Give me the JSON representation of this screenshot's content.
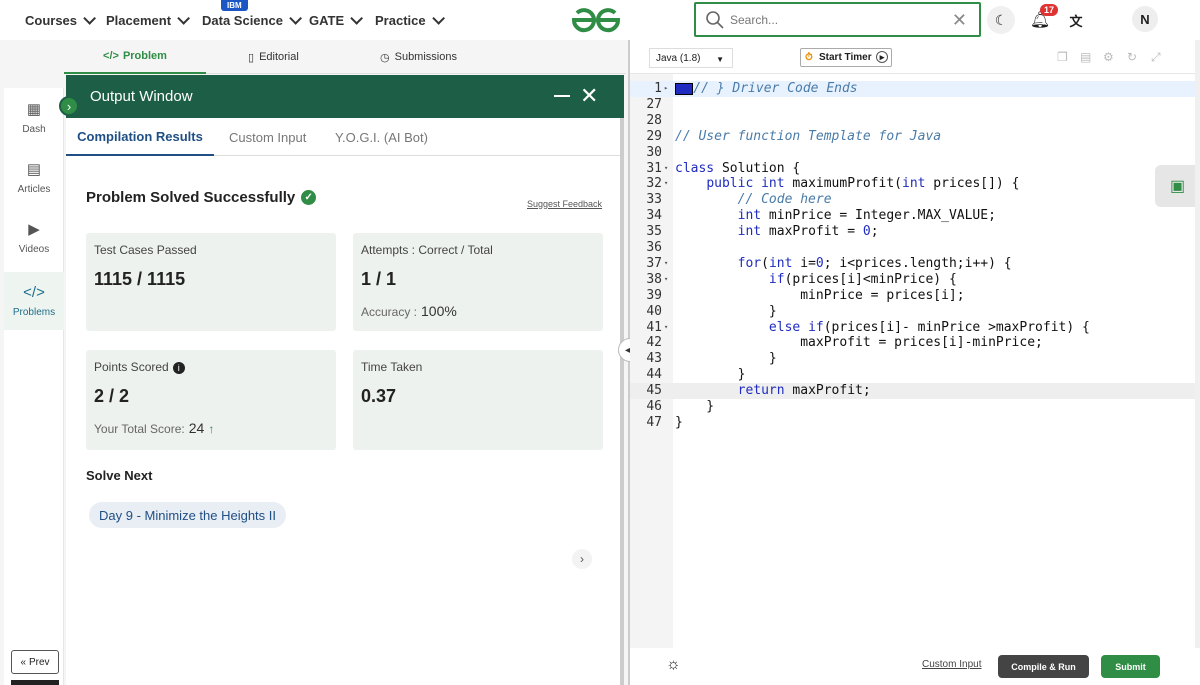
{
  "nav": {
    "items": [
      {
        "label": "Courses"
      },
      {
        "label": "Placement"
      },
      {
        "label": "Data Science"
      },
      {
        "label": "GATE"
      },
      {
        "label": "Practice"
      }
    ],
    "ibm_badge": "IBM",
    "search_placeholder": "Search...",
    "notification_count": "17",
    "avatar_initial": "N"
  },
  "problem_tabs": [
    "Problem",
    "Editorial",
    "Submissions"
  ],
  "sidebar": {
    "items": [
      {
        "label": "Dash",
        "icon": "dashboard-icon"
      },
      {
        "label": "Articles",
        "icon": "book-icon"
      },
      {
        "label": "Videos",
        "icon": "video-icon"
      },
      {
        "label": "Problems",
        "icon": "code-icon"
      }
    ],
    "prev_label": "Prev"
  },
  "output": {
    "title": "Output Window",
    "tabs": [
      "Compilation Results",
      "Custom Input",
      "Y.O.G.I. (AI Bot)"
    ],
    "status": "Problem Solved Successfully",
    "suggest": "Suggest Feedback",
    "cards": {
      "test_label": "Test Cases Passed",
      "test_value": "1115 / 1115",
      "attempts_label": "Attempts : Correct / Total",
      "attempts_value": "1 / 1",
      "accuracy_label": "Accuracy :",
      "accuracy_value": "100%",
      "points_label": "Points Scored",
      "points_value": "2 / 2",
      "score_label": "Your Total Score:",
      "score_value": "24",
      "time_label": "Time Taken",
      "time_value": "0.37"
    },
    "solve_next_label": "Solve Next",
    "next_problem": "Day 9 - Minimize the Heights II"
  },
  "editor": {
    "language": "Java (1.8)",
    "timer_label": "Start Timer",
    "lines": [
      {
        "n": "1",
        "t": "// } Driver Code Ends"
      },
      {
        "n": "27",
        "t": ""
      },
      {
        "n": "28",
        "t": ""
      },
      {
        "n": "29",
        "t": "// User function Template for Java"
      },
      {
        "n": "30",
        "t": ""
      },
      {
        "n": "31",
        "t": "class Solution {"
      },
      {
        "n": "32",
        "t": "    public int maximumProfit(int prices[]) {"
      },
      {
        "n": "33",
        "t": "        // Code here"
      },
      {
        "n": "34",
        "t": "        int minPrice = Integer.MAX_VALUE;"
      },
      {
        "n": "35",
        "t": "        int maxProfit = 0;"
      },
      {
        "n": "36",
        "t": ""
      },
      {
        "n": "37",
        "t": "        for(int i=0; i<prices.length;i++) {"
      },
      {
        "n": "38",
        "t": "            if(prices[i]<minPrice) {"
      },
      {
        "n": "39",
        "t": "                minPrice = prices[i];"
      },
      {
        "n": "40",
        "t": "            }"
      },
      {
        "n": "41",
        "t": "            else if(prices[i]- minPrice >maxProfit) {"
      },
      {
        "n": "42",
        "t": "                maxProfit = prices[i]-minPrice;"
      },
      {
        "n": "43",
        "t": "            }"
      },
      {
        "n": "44",
        "t": "        }"
      },
      {
        "n": "45",
        "t": "        return maxProfit;"
      },
      {
        "n": "46",
        "t": "    }"
      },
      {
        "n": "47",
        "t": "}"
      }
    ],
    "custom_input": "Custom Input",
    "compile_run": "Compile & Run",
    "submit": "Submit"
  },
  "colors": {
    "brand_green": "#2f8d46",
    "header_green": "#1d5e46",
    "link_blue": "#1f4f85"
  }
}
